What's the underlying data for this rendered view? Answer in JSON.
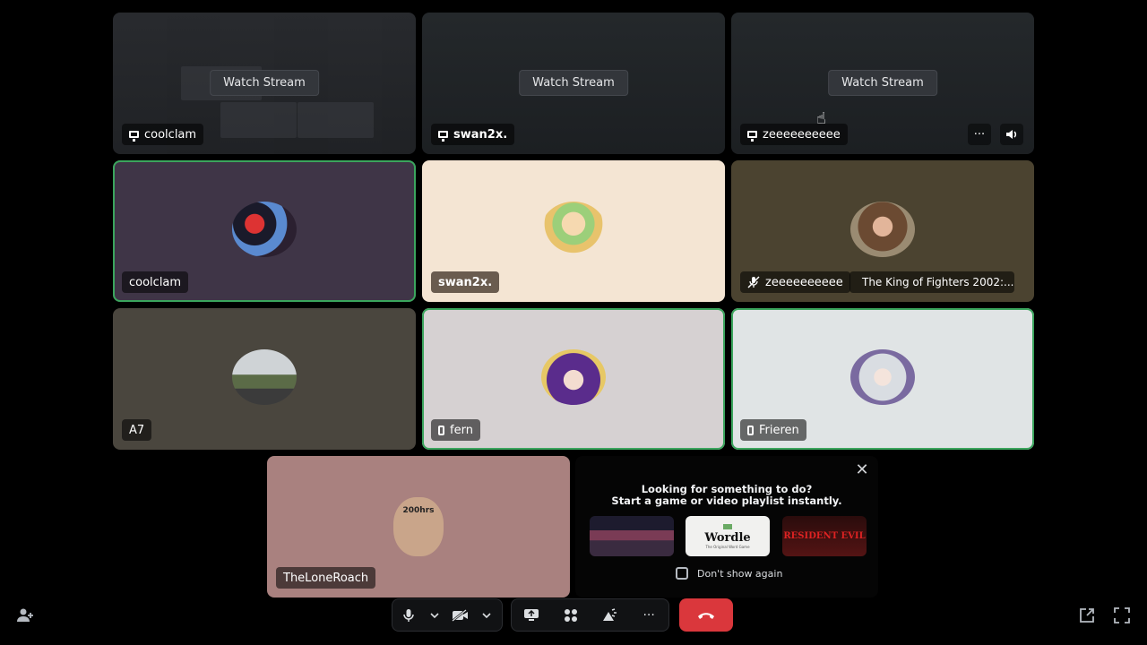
{
  "streams": [
    {
      "name": "coolclam",
      "watch_label": "Watch Stream"
    },
    {
      "name": "swan2x.",
      "watch_label": "Watch Stream"
    },
    {
      "name": "zeeeeeeeeee",
      "watch_label": "Watch Stream"
    }
  ],
  "participants": [
    {
      "name": "coolclam",
      "color": "#3f3547"
    },
    {
      "name": "swan2x.",
      "color": "#f4e5d3"
    },
    {
      "name": "zeeeeeeeeee",
      "color": "#4b4330",
      "activity": "The King of Fighters 2002:..."
    },
    {
      "name": "A7",
      "color": "#4a463e"
    },
    {
      "name": "fern",
      "color": "#d6d1d2"
    },
    {
      "name": "Frieren",
      "color": "#e0e4e5"
    },
    {
      "name": "TheLoneRoach",
      "color": "#a9817f",
      "avatar_text": "200hrs"
    }
  ],
  "suggest": {
    "title_line1": "Looking for something to do?",
    "title_line2": "Start a game or video playlist instantly.",
    "games": [
      {
        "name": "Wordle",
        "subtitle": "The Original Word Game"
      },
      {
        "name": "RESIDENT EVIL"
      }
    ],
    "dont_show": "Don't show again"
  },
  "controls": {
    "more": "···"
  },
  "colors": {
    "speaking": "#3ba55d",
    "end_call": "#da373c"
  }
}
